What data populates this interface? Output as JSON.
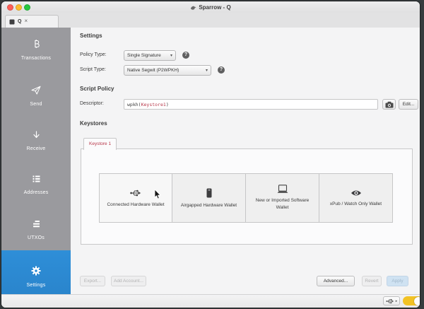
{
  "colors": {
    "accent": "#2e8ed8",
    "sidebar": "#9a9a9e",
    "keystoreRed": "#b8384a",
    "toggleYellow": "#f2c224",
    "trafficRed": "#ff5f57",
    "trafficYellow": "#febc2e",
    "trafficGreen": "#28c840"
  },
  "window": {
    "title": "Sparrow - Q"
  },
  "tabbar": {
    "tab": {
      "label": "Q",
      "close_glyph": "×"
    }
  },
  "sidebar": {
    "items": [
      {
        "label": "Transactions"
      },
      {
        "label": "Send"
      },
      {
        "label": "Receive"
      },
      {
        "label": "Addresses"
      },
      {
        "label": "UTXOs"
      },
      {
        "label": "Settings"
      }
    ]
  },
  "content": {
    "settings_heading": "Settings",
    "policy_type_label": "Policy Type:",
    "policy_type_value": "Single Signature",
    "script_type_label": "Script Type:",
    "script_type_value": "Native Segwit (P2WPKH)",
    "help_glyph": "?",
    "caret_glyph": "▾",
    "script_policy_heading": "Script Policy",
    "descriptor_label": "Descriptor:",
    "descriptor_prefix": "wpkh(",
    "descriptor_keystore": "Keystore1",
    "descriptor_suffix": ")",
    "edit_button": "Edit...",
    "keystores_heading": "Keystores",
    "keystore_tab": "Keystore 1",
    "wallet_options": [
      {
        "label": "Connected Hardware Wallet"
      },
      {
        "label": "Airgapped Hardware Wallet"
      },
      {
        "label": "New or Imported Software Wallet"
      },
      {
        "label": "xPub / Watch Only Wallet"
      }
    ],
    "footer": {
      "export": "Export...",
      "add_account": "Add Account...",
      "advanced": "Advanced...",
      "revert": "Revert",
      "apply": "Apply"
    }
  },
  "statusbar": {
    "usb_caret_glyph": "▸"
  }
}
